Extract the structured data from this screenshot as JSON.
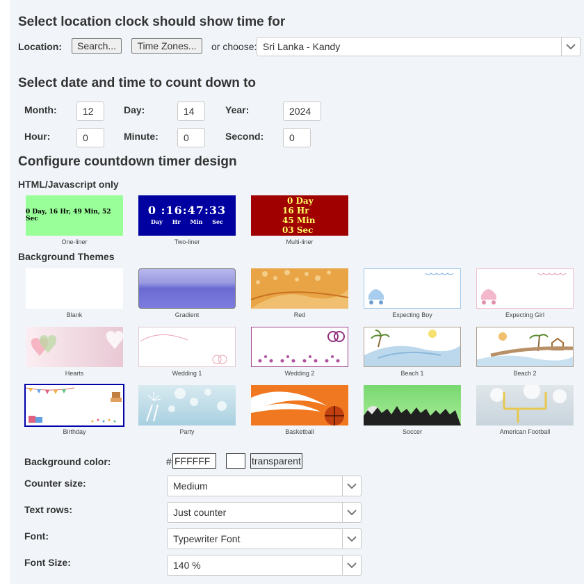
{
  "location": {
    "heading": "Select location clock should show time for",
    "label": "Location:",
    "search_button": "Search...",
    "timezones_button": "Time Zones...",
    "or_choose": "or choose:",
    "selected": "Sri Lanka - Kandy"
  },
  "date": {
    "heading": "Select date and time to count down to",
    "month_label": "Month:",
    "month": "12",
    "day_label": "Day:",
    "day": "14",
    "year_label": "Year:",
    "year": "2024",
    "hour_label": "Hour:",
    "hour": "0",
    "minute_label": "Minute:",
    "minute": "0",
    "second_label": "Second:",
    "second": "0"
  },
  "design": {
    "heading": "Configure countdown timer design",
    "html_heading": "HTML/Javascript only",
    "html_styles": [
      {
        "caption": "One-liner",
        "preview": "0 Day, 16 Hr, 49 Min, 52 Sec",
        "bg": "#99ff99",
        "fg": "#000000"
      },
      {
        "caption": "Two-liner",
        "preview": "0 :16:47:33",
        "units": [
          "Day",
          "Hr",
          "Min",
          "Sec"
        ],
        "bg": "#0000a0",
        "fg": "#ffffff"
      },
      {
        "caption": "Multi-liner",
        "lines": [
          "0 Day",
          "16 Hr",
          "45 Min",
          "03 Sec"
        ],
        "bg": "#a00000",
        "fg": "#ffff66"
      }
    ],
    "themes_heading": "Background Themes",
    "themes": [
      {
        "caption": "Blank"
      },
      {
        "caption": "Gradient"
      },
      {
        "caption": "Red"
      },
      {
        "caption": "Expecting Boy"
      },
      {
        "caption": "Expecting Girl"
      },
      {
        "caption": "Hearts"
      },
      {
        "caption": "Wedding 1"
      },
      {
        "caption": "Wedding 2"
      },
      {
        "caption": "Beach 1"
      },
      {
        "caption": "Beach 2"
      },
      {
        "caption": "Birthday",
        "selected": true
      },
      {
        "caption": "Party"
      },
      {
        "caption": "Basketball"
      },
      {
        "caption": "Soccer"
      },
      {
        "caption": "American Football"
      }
    ]
  },
  "settings": {
    "bg_color_label": "Background color:",
    "hash": "#",
    "bg_color_value": "FFFFFF",
    "transparent_label": "transparent",
    "counter_size_label": "Counter size:",
    "counter_size": "Medium",
    "text_rows_label": "Text rows:",
    "text_rows": "Just counter",
    "font_label": "Font:",
    "font": "Typewriter Font",
    "font_size_label": "Font Size:",
    "font_size": "140 %"
  }
}
